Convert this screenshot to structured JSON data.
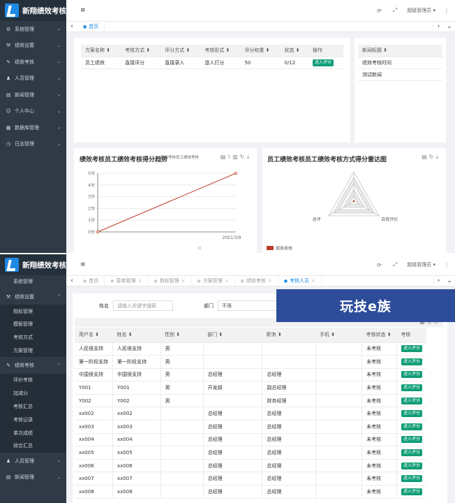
{
  "app": {
    "name": "新翔绩效考核"
  },
  "topbar": {
    "user": "超级管理员"
  },
  "menu1": [
    {
      "icon": "⚙",
      "label": "系统管理"
    },
    {
      "icon": "⚒",
      "label": "绩效设置"
    },
    {
      "icon": "✎",
      "label": "绩效考核"
    },
    {
      "icon": "♟",
      "label": "人员管理"
    },
    {
      "icon": "▤",
      "label": "新闻管理"
    },
    {
      "icon": "☺",
      "label": "个人中心"
    },
    {
      "icon": "▦",
      "label": "数据库管理"
    },
    {
      "icon": "◷",
      "label": "日志管理"
    }
  ],
  "tabs1": {
    "home": "首页"
  },
  "plan_table": {
    "headers": [
      "方案名称",
      "考核方式",
      "评分方式",
      "考核形式",
      "评分权重",
      "状态",
      "操作"
    ],
    "row": [
      "员工绩效",
      "直接评分",
      "直接录入",
      "逐人打分",
      "50",
      "0/12",
      "进入评分"
    ]
  },
  "news": {
    "header": "新闻标题",
    "items": [
      "绩效考核时间",
      "测试新闻"
    ]
  },
  "line_chart": {
    "title": "绩效考核员工绩效考核得分趋势",
    "legend": "绩效考核员工绩效考核"
  },
  "radar_chart": {
    "title": "员工绩效考核员工绩效考核方式得分雷达图",
    "labels": [
      "",
      "自我评价",
      "总评"
    ],
    "legend": "绩效考核"
  },
  "chart_data": [
    {
      "type": "line",
      "title": "绩效考核员工绩效考核得分趋势",
      "x": [
        "",
        "2021/3/9"
      ],
      "values": [
        0,
        5
      ],
      "yticks": [
        "0分",
        "1分",
        "2分",
        "3分",
        "4分",
        "5分"
      ],
      "ylim": [
        0,
        5
      ],
      "grid": true
    },
    {
      "type": "radar",
      "title": "员工绩效考核员工绩效考核方式得分雷达图",
      "axes": [
        "",
        "自我评价",
        "总评"
      ],
      "series": [
        {
          "name": "绩效考核",
          "values": [
            0,
            0,
            0
          ]
        }
      ]
    }
  ],
  "tabs2": [
    {
      "label": "首页",
      "active": false,
      "close": false
    },
    {
      "label": "菜单管理",
      "active": false,
      "close": true
    },
    {
      "label": "指标管理",
      "active": false,
      "close": true
    },
    {
      "label": "方案管理",
      "active": false,
      "close": true
    },
    {
      "label": "绩效考核",
      "active": false,
      "close": true
    },
    {
      "label": "考核人员",
      "active": true,
      "close": true
    }
  ],
  "menu2": {
    "cut_item": "系统管理",
    "group1": "绩效设置",
    "group1_items": [
      "指标管理",
      "模板管理",
      "考核方式",
      "方案管理"
    ],
    "group2": "绩效考核",
    "group2_items": [
      "评价考核",
      "加减分",
      "考核汇总",
      "考核记录",
      "单次成绩",
      "综合汇总"
    ],
    "bottom": [
      "人员管理",
      "新闻管理"
    ]
  },
  "filters": {
    "name_label": "姓名",
    "name_placeholder": "请输入关键字搜索",
    "dept_label": "部门",
    "dept_value": "不限"
  },
  "banner": {
    "text": "玩技e族"
  },
  "staff_table": {
    "headers": [
      "用户名",
      "姓名",
      "性别",
      "部门",
      "职务",
      "手机",
      "考核状态",
      "考核"
    ],
    "rows": [
      [
        "人民很支持",
        "人民很支持",
        "男",
        "",
        "",
        "",
        "未考核",
        "进入评分"
      ],
      [
        "第一阶段支持",
        "第一阶段支持",
        "男",
        "",
        "",
        "",
        "未考核",
        "进入评分"
      ],
      [
        "中国很支持",
        "中国很支持",
        "男",
        "总经理",
        "总经理",
        "",
        "未考核",
        "进入评分"
      ],
      [
        "Y001",
        "Y001",
        "男",
        "开发部",
        "副总经理",
        "",
        "未考核",
        "进入评分"
      ],
      [
        "Y002",
        "Y002",
        "男",
        "",
        "财务经理",
        "",
        "未考核",
        "进入评分"
      ],
      [
        "xx002",
        "xx002",
        "",
        "总经理",
        "总经理",
        "",
        "未考核",
        "进入评分"
      ],
      [
        "xx003",
        "xx003",
        "",
        "总经理",
        "总经理",
        "",
        "未考核",
        "进入评分"
      ],
      [
        "xx004",
        "xx004",
        "",
        "总经理",
        "总经理",
        "",
        "未考核",
        "进入评分"
      ],
      [
        "xx005",
        "xx005",
        "",
        "总经理",
        "总经理",
        "",
        "未考核",
        "进入评分"
      ],
      [
        "xx006",
        "xx006",
        "",
        "总经理",
        "总经理",
        "",
        "未考核",
        "进入评分"
      ],
      [
        "xx007",
        "xx007",
        "",
        "总经理",
        "总经理",
        "",
        "未考核",
        "进入评分"
      ],
      [
        "xx008",
        "xx008",
        "",
        "总经理",
        "总经理",
        "",
        "未考核",
        "进入评分"
      ]
    ]
  },
  "colors": {
    "sidebar": "#2f3a46",
    "accent": "#1e88e5",
    "button": "#0f9d76",
    "line": "#c0392b"
  }
}
